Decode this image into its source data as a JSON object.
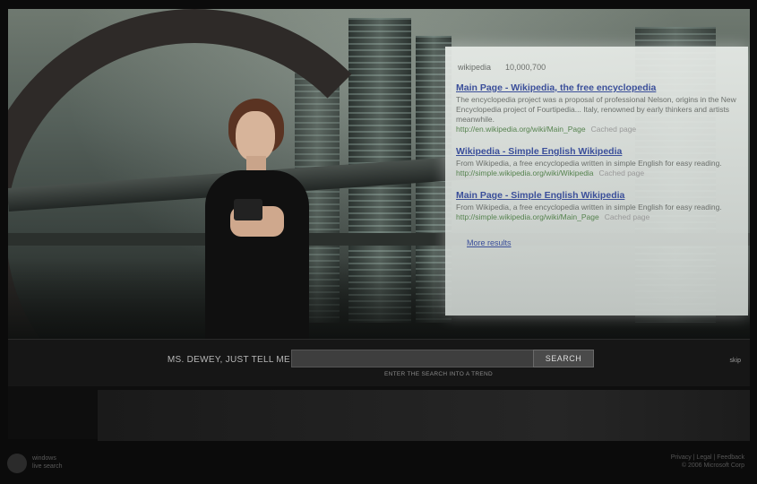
{
  "results": {
    "query": "wikipedia",
    "count": "10,000,700",
    "items": [
      {
        "title": "Main Page - Wikipedia, the free encyclopedia",
        "snippet": "The encyclopedia project was a proposal of professional Nelson, origins in the New Encyclopedia project of Fourtipedia... Italy, renowned by early thinkers and artists meanwhile.",
        "url": "http://en.wikipedia.org/wiki/Main_Page",
        "cache": "Cached page"
      },
      {
        "title": "Wikipedia - Simple English Wikipedia",
        "snippet": "From Wikipedia, a free encyclopedia written in simple English for easy reading.",
        "url": "http://simple.wikipedia.org/wiki/Wikipedia",
        "cache": "Cached page"
      },
      {
        "title": "Main Page - Simple English Wikipedia",
        "snippet": "From Wikipedia, a free encyclopedia written in simple English for easy reading.",
        "url": "http://simple.wikipedia.org/wiki/Main_Page",
        "cache": "Cached page"
      }
    ],
    "more_label": "More results"
  },
  "search": {
    "prompt": "MS. DEWEY, JUST TELL ME",
    "value": "",
    "button": "SEARCH",
    "hint": "ENTER THE SEARCH INTO A TREND",
    "side_label": "skip"
  },
  "footer": {
    "logo_line1": "windows",
    "logo_line2": "live search",
    "legal_line1": "Privacy | Legal | Feedback",
    "legal_line2": "© 2006 Microsoft Corp"
  },
  "colors": {
    "link": "#3b4f9a",
    "url": "#56834f",
    "panel": "#161616"
  }
}
